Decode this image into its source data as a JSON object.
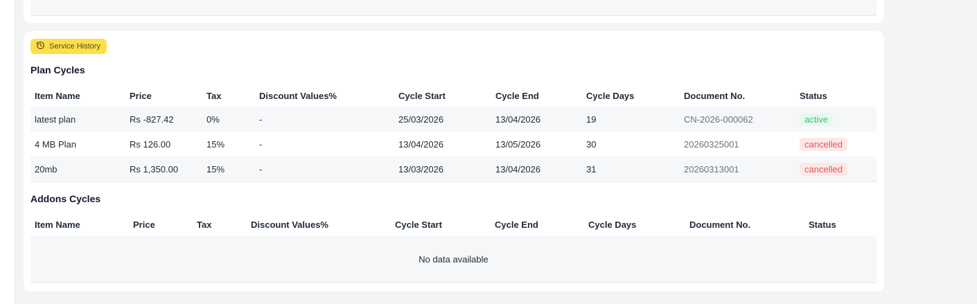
{
  "service_history": {
    "badge_label": "Service History",
    "plan_cycles": {
      "title": "Plan Cycles",
      "columns": [
        "Item Name",
        "Price",
        "Tax",
        "Discount Values%",
        "Cycle Start",
        "Cycle End",
        "Cycle Days",
        "Document No.",
        "Status"
      ],
      "rows": [
        [
          "latest plan",
          "Rs -827.42",
          "0%",
          "-",
          "25/03/2026",
          "13/04/2026",
          "19",
          "CN-2026-000062",
          "active"
        ],
        [
          "4 MB Plan",
          "Rs 126.00",
          "15%",
          "-",
          "13/04/2026",
          "13/05/2026",
          "30",
          "20260325001",
          "cancelled"
        ],
        [
          "20mb",
          "Rs 1,350.00",
          "15%",
          "-",
          "13/03/2026",
          "13/04/2026",
          "31",
          "20260313001",
          "cancelled"
        ]
      ]
    },
    "addons_cycles": {
      "title": "Addons Cycles",
      "columns": [
        "Item Name",
        "Price",
        "Tax",
        "Discount Values%",
        "Cycle Start",
        "Cycle End",
        "Cycle Days",
        "Document No.",
        "Status"
      ],
      "empty_message": "No data available"
    }
  }
}
